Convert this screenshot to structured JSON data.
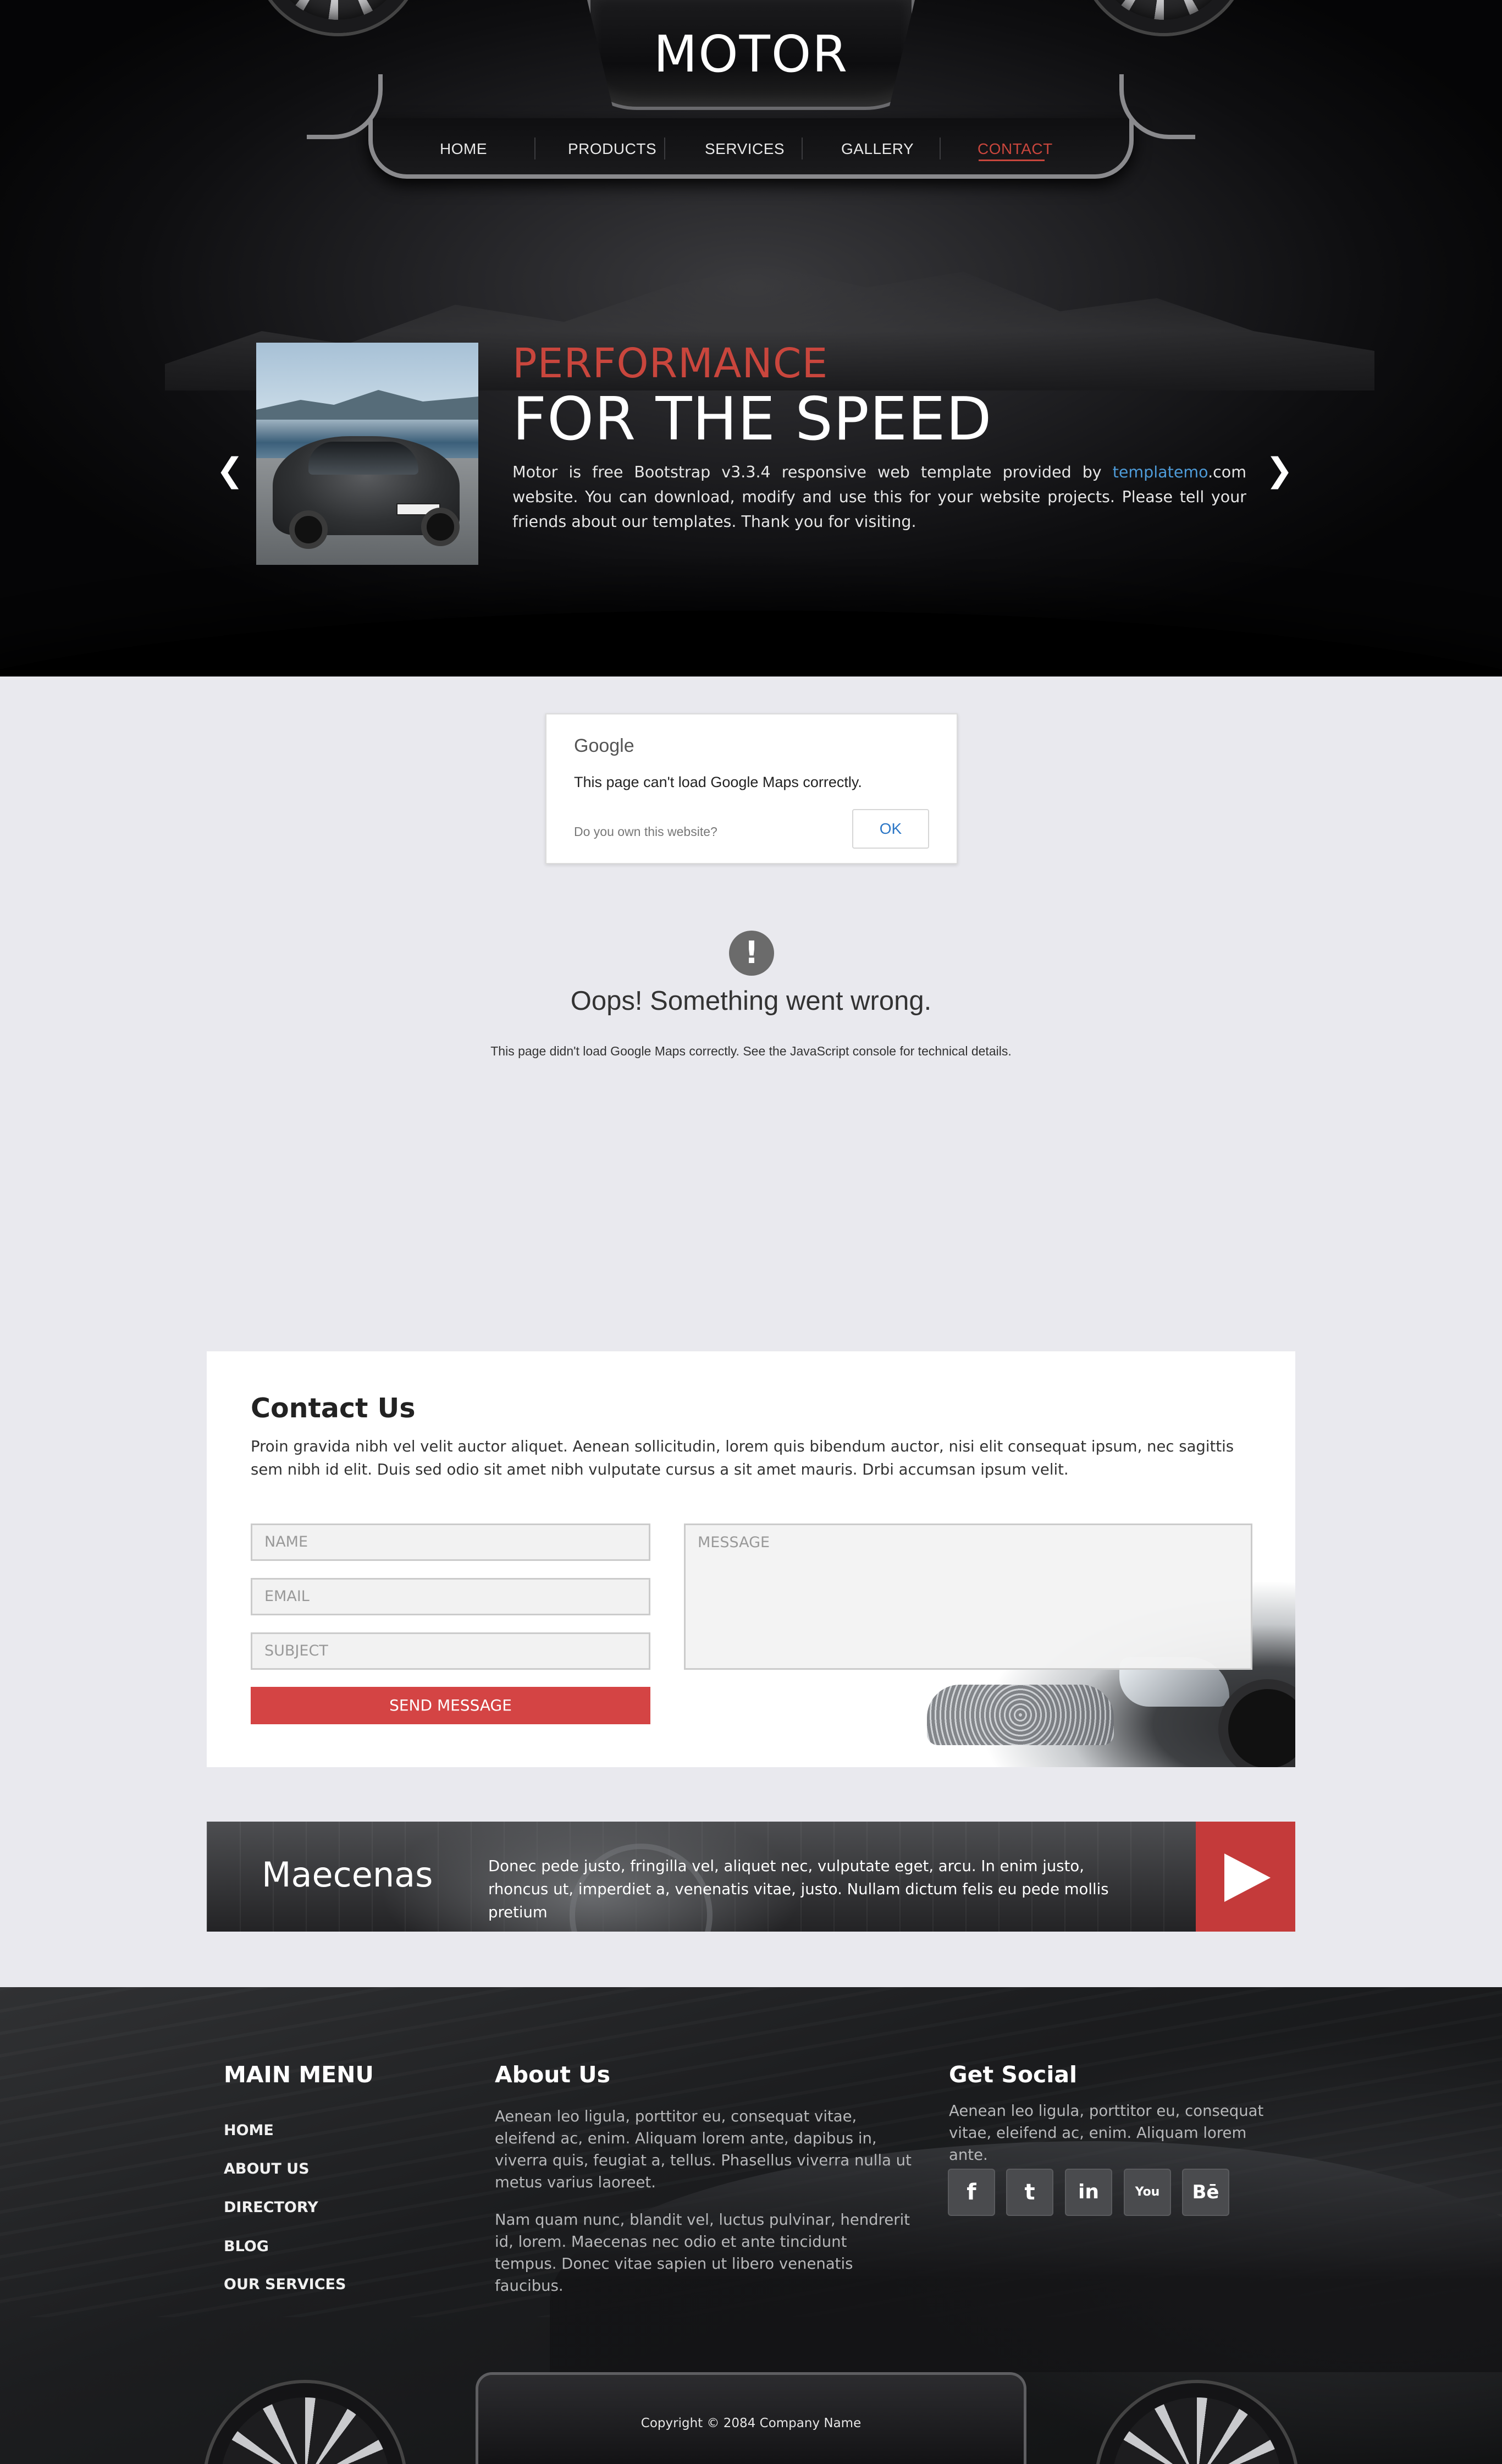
{
  "brand": {
    "logo": "MOTOR"
  },
  "nav": {
    "items": [
      {
        "label": "HOME"
      },
      {
        "label": "PRODUCTS"
      },
      {
        "label": "SERVICES"
      },
      {
        "label": "GALLERY"
      },
      {
        "label": "CONTACT",
        "active": true
      }
    ]
  },
  "hero": {
    "kicker": "PERFORMANCE",
    "title": "FOR THE SPEED",
    "text_before_link": "Motor is free Bootstrap v3.3.4 responsive web template provided by ",
    "link_text": "templatemo",
    "text_after_link": ".com website. You can download, modify and use this for your website projects. Please tell your friends about our templates. Thank you for visiting.",
    "prev_icon": "chevron-left-icon",
    "next_icon": "chevron-right-icon"
  },
  "map": {
    "dialog": {
      "brand": "Google",
      "message": "This page can't load Google Maps correctly.",
      "question": "Do you own this website?",
      "ok_label": "OK"
    },
    "error_icon": "!",
    "error_title": "Oops! Something went wrong.",
    "error_detail": "This page didn't load Google Maps correctly. See the JavaScript console for technical details."
  },
  "contact": {
    "title": "Contact Us",
    "intro": "Proin gravida nibh vel velit auctor aliquet. Aenean sollicitudin, lorem quis bibendum auctor, nisi elit consequat ipsum, nec sagittis sem nibh id elit. Duis sed odio sit amet nibh vulputate cursus a sit amet mauris. Drbi accumsan ipsum velit.",
    "fields": {
      "name_placeholder": "NAME",
      "email_placeholder": "EMAIL",
      "subject_placeholder": "SUBJECT",
      "message_placeholder": "MESSAGE"
    },
    "send_label": "SEND MESSAGE"
  },
  "banner": {
    "title": "Maecenas",
    "text": "Donec pede justo, fringilla vel, aliquet nec, vulputate eget, arcu. In enim justo, rhoncus ut, imperdiet a, venenatis vitae, justo. Nullam dictum felis eu pede mollis pretium",
    "play_icon": "play-icon",
    "accent": "#c43a3a"
  },
  "footer": {
    "main_menu": {
      "title": "MAIN MENU",
      "items": [
        "HOME",
        "ABOUT US",
        "DIRECTORY",
        "BLOG",
        "OUR SERVICES"
      ]
    },
    "about": {
      "title": "About Us",
      "p1": "Aenean leo ligula, porttitor eu, consequat vitae, eleifend ac, enim. Aliquam lorem ante, dapibus in, viverra quis, feugiat a, tellus. Phasellus viverra nulla ut metus varius laoreet.",
      "p2": "Nam quam nunc, blandit vel, luctus pulvinar, hendrerit id, lorem. Maecenas nec odio et ante tincidunt tempus. Donec vitae sapien ut libero venenatis faucibus."
    },
    "social": {
      "title": "Get Social",
      "text": "Aenean leo ligula, porttitor eu, consequat vitae, eleifend ac, enim. Aliquam lorem ante.",
      "icons": [
        {
          "name": "facebook-icon",
          "glyph": "f"
        },
        {
          "name": "twitter-icon",
          "glyph": "t"
        },
        {
          "name": "linkedin-icon",
          "glyph": "in"
        },
        {
          "name": "youtube-icon",
          "glyph": "You"
        },
        {
          "name": "behance-icon",
          "glyph": "Bē"
        }
      ]
    },
    "copyright": "Copyright © 2084 Company Name"
  },
  "colors": {
    "accent_red": "#c9463d",
    "link_blue": "#4e9bd8",
    "button_red": "#d44444"
  }
}
